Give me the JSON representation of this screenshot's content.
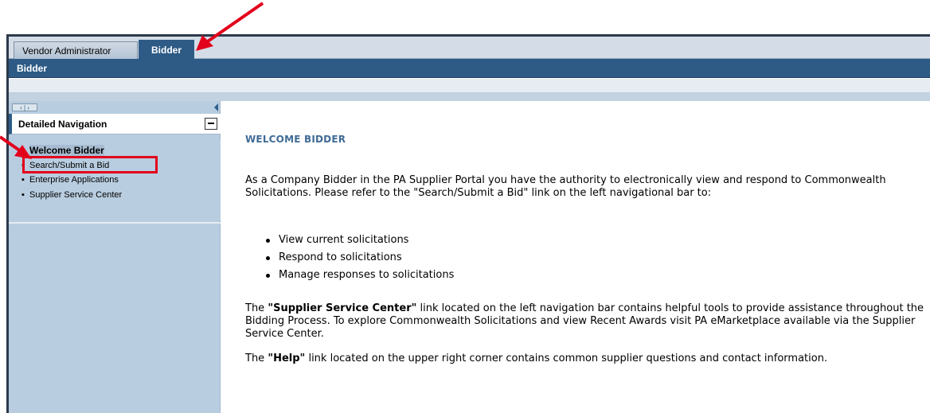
{
  "tabs": [
    {
      "label": "Vendor Administrator",
      "active": false
    },
    {
      "label": "Bidder",
      "active": true
    }
  ],
  "subnav": {
    "label": "Bidder"
  },
  "nav": {
    "controls": "‹ | ›",
    "header": "Detailed Navigation",
    "items": [
      {
        "label": "Welcome Bidder",
        "selected": true
      },
      {
        "label": "Search/Submit a Bid",
        "selected": false
      },
      {
        "label": "Enterprise Applications",
        "selected": false
      },
      {
        "label": "Supplier Service Center",
        "selected": false
      }
    ]
  },
  "content": {
    "title": "WELCOME BIDDER",
    "p1": "As a Company Bidder in the PA Supplier Portal you have the authority to electronically view and respond to Commonwealth Solicitations.  Please refer to the \"Search/Submit a Bid\" link on the left navigational bar to:",
    "bullets": [
      "View current solicitations",
      "Respond to solicitations",
      "Manage responses to solicitations"
    ],
    "p2_strong": "\"Supplier Service Center\"",
    "p2_prefix": "The ",
    "p2_rest": " link located on the left navigation bar contains helpful tools to provide assistance throughout the Bidding Process.  To explore Commonwealth Solicitations and view Recent Awards visit PA eMarketplace available via the Supplier Service Center.",
    "p3_prefix": "The ",
    "p3_strong": "\"Help\"",
    "p3_rest": " link located on the upper right corner contains common supplier questions and contact information."
  },
  "colors": {
    "annotation": "#e3001b",
    "brand_blue": "#2d5b86",
    "nav_bg": "#b8cde0",
    "title_blue": "#3f6b96"
  }
}
